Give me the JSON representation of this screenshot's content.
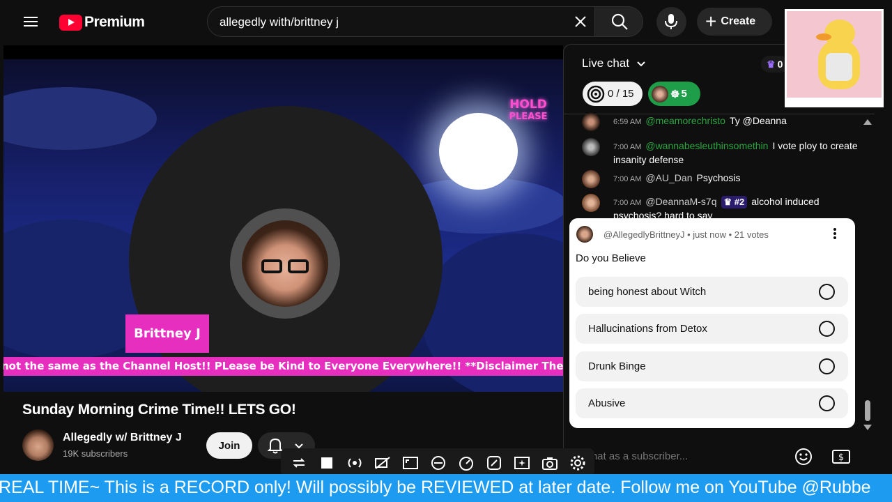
{
  "topbar": {
    "logo_text": "Premium",
    "search_value": "allegedly with/brittney j",
    "create_label": "Create"
  },
  "player": {
    "hold_line1": "HOLD",
    "hold_line2": "PLEASE",
    "name_badge": "Brittney J",
    "ticker": "not the same as the Channel Host!! PLease be Kind to Everyone Everywhere!! **Disclaimer The Mode"
  },
  "video": {
    "title": "Sunday Morning Crime Time!! LETS GO!",
    "channel_name": "Allegedly w/ Brittney J",
    "subscribers": "19K subscribers",
    "join_label": "Join"
  },
  "chat": {
    "title": "Live chat",
    "goal_progress": "0 / 15",
    "members_count": "5",
    "crown_count": "0",
    "messages": [
      {
        "time": "6:59 AM",
        "author": "@meamorechristo",
        "text": "Ty @Deanna"
      },
      {
        "time": "7:00 AM",
        "author": "@wannabesleuthinsomethin",
        "text": "I vote ploy to create insanity defense"
      },
      {
        "time": "7:00 AM",
        "author": "@AU_Dan",
        "text": "Psychosis"
      },
      {
        "time": "7:00 AM",
        "author": "@DeannaM-s7q",
        "rank": "#2",
        "text": "alcohol induced psychosis? hard to say"
      }
    ],
    "input_placeholder": "Chat as a subscriber..."
  },
  "poll": {
    "meta": "@AllegedlyBrittneyJ • just now • 21 votes",
    "question": "Do you Believe",
    "options": [
      {
        "label": "being honest about Witch"
      },
      {
        "label": "Hallucinations from Detox"
      },
      {
        "label": "Drunk Binge"
      },
      {
        "label": "Abusive"
      }
    ]
  },
  "bottom_ticker": "REAL TIME~ This is a RECORD only! Will possibly be REVIEWED at later date. Follow me on YouTube @Rubbe",
  "colors": {
    "accent_pink": "#e72fbf",
    "ticker_blue": "#1d9bf0",
    "members_green": "#1f9e4a",
    "author_green": "#2ba640"
  }
}
